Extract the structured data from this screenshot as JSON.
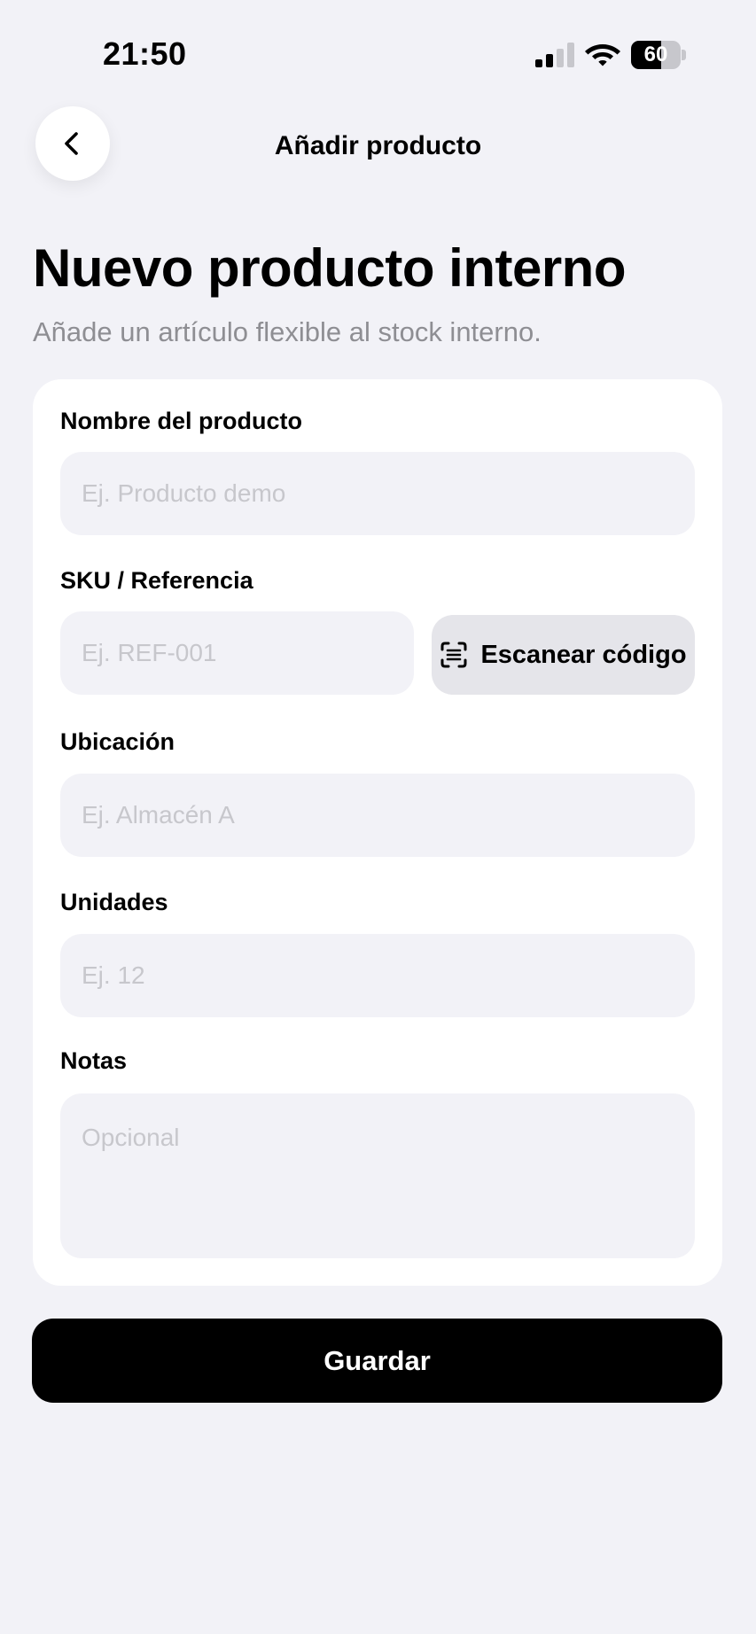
{
  "status_bar": {
    "time": "21:50",
    "battery": 60
  },
  "nav": {
    "title": "Añadir producto",
    "back_icon": "chevron-left-icon"
  },
  "header": {
    "title": "Nuevo producto interno",
    "subtitle": "Añade un artículo flexible al stock interno."
  },
  "form": {
    "name": {
      "label": "Nombre del producto",
      "placeholder": "Ej. Producto demo",
      "value": ""
    },
    "sku": {
      "label": "SKU / Referencia",
      "placeholder": "Ej. REF-001",
      "value": ""
    },
    "scan_button": {
      "label": "Escanear código",
      "icon": "barcode-scan-icon"
    },
    "location": {
      "label": "Ubicación",
      "placeholder": "Ej. Almacén A",
      "value": ""
    },
    "units": {
      "label": "Unidades",
      "placeholder": "Ej. 12",
      "value": ""
    },
    "notes": {
      "label": "Notas",
      "placeholder": "Opcional",
      "value": ""
    }
  },
  "actions": {
    "save_label": "Guardar"
  },
  "colors": {
    "background": "#f2f2f7",
    "card": "#ffffff",
    "input": "#f2f2f7",
    "primary": "#000000",
    "placeholder": "#c7c7cc",
    "subtitle": "#8e8e93"
  }
}
